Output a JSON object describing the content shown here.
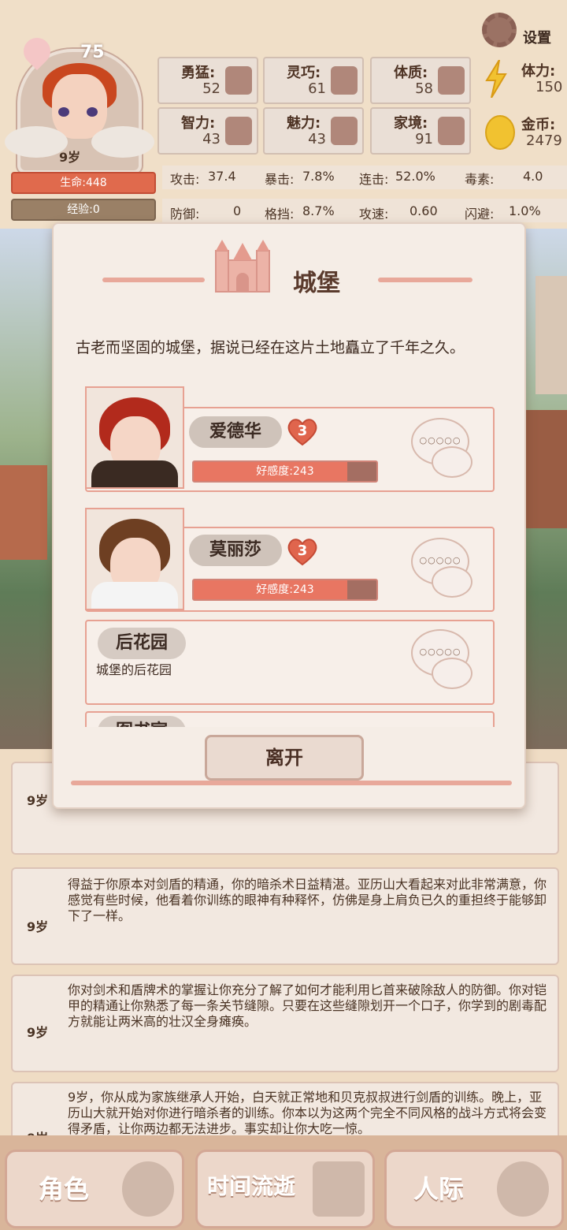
{
  "player": {
    "level": "75",
    "age": "9岁",
    "hp_label": "生命:448",
    "exp_label": "经验:0"
  },
  "settings": {
    "label": "设置",
    "icon": "gear-icon"
  },
  "attributes": [
    {
      "label": "勇猛:",
      "value": "52",
      "icon": "fist-icon"
    },
    {
      "label": "灵巧:",
      "value": "61",
      "icon": "cloak-icon"
    },
    {
      "label": "体质:",
      "value": "58",
      "icon": "muscle-icon"
    },
    {
      "label": "智力:",
      "value": "43",
      "icon": "brain-icon"
    },
    {
      "label": "魅力:",
      "value": "43",
      "icon": "tulip-icon"
    },
    {
      "label": "家境:",
      "value": "91",
      "icon": "house-icon"
    }
  ],
  "resources": {
    "stamina_label": "体力:",
    "stamina_value": "150",
    "gold_label": "金币:",
    "gold_value": "2479"
  },
  "combat": [
    {
      "label": "攻击:",
      "value": "37.4"
    },
    {
      "label": "暴击:",
      "value": "7.8%"
    },
    {
      "label": "连击:",
      "value": "52.0%"
    },
    {
      "label": "毒素:",
      "value": "4.0"
    },
    {
      "label": "防御:",
      "value": "0"
    },
    {
      "label": "格挡:",
      "value": "8.7%"
    },
    {
      "label": "攻速:",
      "value": "0.60"
    },
    {
      "label": "闪避:",
      "value": "1.0%"
    }
  ],
  "dialog": {
    "title": "城堡",
    "description": "古老而坚固的城堡，据说已经在这片土地矗立了千年之久。",
    "characters": [
      {
        "name": "爱德华",
        "hearts": "3",
        "affinity_label": "好感度:243",
        "affinity_fraction": 0.84,
        "hair": "#b22a1c",
        "body": "#3a2a22"
      },
      {
        "name": "莫丽莎",
        "hearts": "3",
        "affinity_label": "好感度:243",
        "affinity_fraction": 0.84,
        "hair": "#6e3f22",
        "body": "#f4f4f4"
      }
    ],
    "location": {
      "name": "后花园",
      "description": "城堡的后花园"
    },
    "partial_name": "图书室",
    "leave_button": "离开",
    "bubble_dots": "○○○○○"
  },
  "log": [
    {
      "age": "9岁",
      "text": ""
    },
    {
      "age": "9岁",
      "text": "得益于你原本对剑盾的精通，你的暗杀术日益精湛。亚历山大看起来对此非常满意，你感觉有些时候，他看着你训练的眼神有种释怀，仿佛是身上肩负已久的重担终于能够卸下了一样。"
    },
    {
      "age": "9岁",
      "text": "你对剑术和盾牌术的掌握让你充分了解了如何才能利用匕首来破除敌人的防御。你对铠甲的精通让你熟悉了每一条关节缝隙。只要在这些缝隙划开一个口子，你学到的剧毒配方就能让两米高的壮汉全身瘫痪。"
    },
    {
      "age": "9岁",
      "text": "9岁，你从成为家族继承人开始，白天就正常地和贝克叔叔进行剑盾的训练。晚上，亚历山大就开始对你进行暗杀者的训练。你本以为这两个完全不同风格的战斗方式将会变得矛盾，让你两边都无法进步。事实却让你大吃一惊。"
    }
  ],
  "nav": [
    {
      "label": "角色",
      "icon": "character-icon"
    },
    {
      "label": "时间流逝",
      "icon": "hourglass-icon"
    },
    {
      "label": "人际",
      "icon": "people-icon"
    }
  ]
}
